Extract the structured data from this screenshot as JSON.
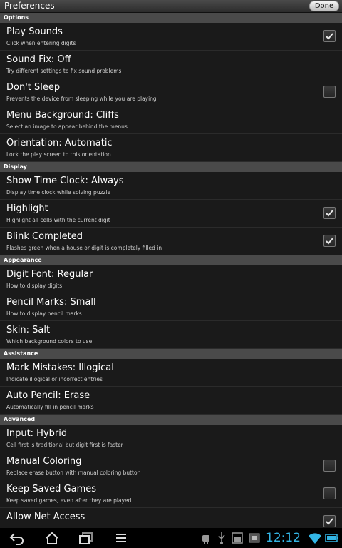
{
  "titlebar": {
    "title": "Preferences",
    "done_label": "Done"
  },
  "sections": [
    {
      "label": "Options",
      "items": [
        {
          "title": "Play Sounds",
          "summary": "Click when entering digits",
          "checkbox": true,
          "checked": true
        },
        {
          "title": "Sound Fix: Off",
          "summary": "Try different settings to fix sound problems",
          "checkbox": false
        },
        {
          "title": "Don't Sleep",
          "summary": "Prevents the device from sleeping while you are playing",
          "checkbox": true,
          "checked": false
        },
        {
          "title": "Menu Background: Cliffs",
          "summary": "Select an image to appear behind the menus",
          "checkbox": false
        },
        {
          "title": "Orientation: Automatic",
          "summary": "Lock the play screen to this orientation",
          "checkbox": false
        }
      ]
    },
    {
      "label": "Display",
      "items": [
        {
          "title": "Show Time Clock: Always",
          "summary": "Display time clock while solving puzzle",
          "checkbox": false
        },
        {
          "title": "Highlight",
          "summary": "Highlight all cells with the current digit",
          "checkbox": true,
          "checked": true
        },
        {
          "title": "Blink Completed",
          "summary": "Flashes green when a house or digit is completely filled in",
          "checkbox": true,
          "checked": true
        }
      ]
    },
    {
      "label": "Appearance",
      "items": [
        {
          "title": "Digit Font: Regular",
          "summary": "How to display digits",
          "checkbox": false
        },
        {
          "title": "Pencil Marks: Small",
          "summary": "How to display pencil marks",
          "checkbox": false
        },
        {
          "title": "Skin: Salt",
          "summary": "Which background colors to use",
          "checkbox": false
        }
      ]
    },
    {
      "label": "Assistance",
      "items": [
        {
          "title": "Mark Mistakes: Illogical",
          "summary": "Indicate illogical or incorrect entries",
          "checkbox": false
        },
        {
          "title": "Auto Pencil: Erase",
          "summary": "Automatically fill in pencil marks",
          "checkbox": false
        }
      ]
    },
    {
      "label": "Advanced",
      "items": [
        {
          "title": "Input: Hybrid",
          "summary": "Cell first is traditional but digit first is faster",
          "checkbox": false
        },
        {
          "title": "Manual Coloring",
          "summary": "Replace erase button with manual coloring button",
          "checkbox": true,
          "checked": false
        },
        {
          "title": "Keep Saved Games",
          "summary": "Keep saved games, even after they are played",
          "checkbox": true,
          "checked": false
        },
        {
          "title": "Allow Net Access",
          "summary": "",
          "checkbox": true,
          "checked": true
        }
      ]
    }
  ],
  "navbar": {
    "buttons": [
      "back-icon",
      "home-icon",
      "recent-apps-icon",
      "menu-icon"
    ],
    "status_icons": [
      "android-debug-icon",
      "usb-icon",
      "sd-card-icon",
      "screenshot-icon"
    ],
    "clock": "12:12",
    "accent": "#33b5e5"
  }
}
